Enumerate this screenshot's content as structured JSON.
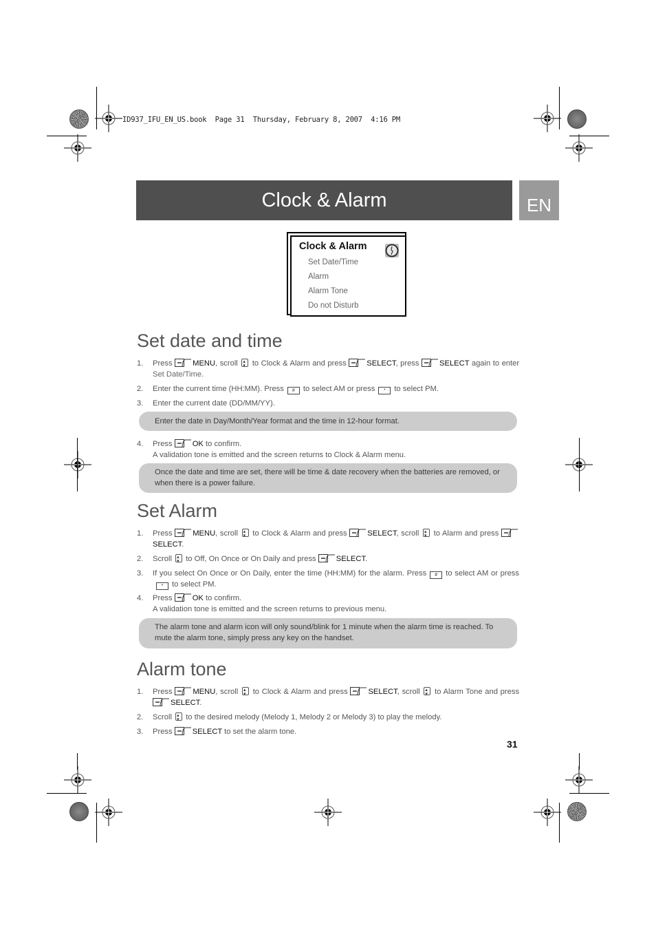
{
  "print_header": {
    "stamp": "ID937_IFU_EN_US.book  Page 31  Thursday, February 8, 2007  4:16 PM"
  },
  "title_band": {
    "title": "Clock & Alarm",
    "language_tab": "EN"
  },
  "menu_screen": {
    "title": "Clock & Alarm",
    "icon": "clock-icon",
    "items": [
      "Set Date/Time",
      "Alarm",
      "Alarm Tone",
      "Do not Disturb"
    ]
  },
  "keys": {
    "menu": "MENU",
    "select": "SELECT",
    "ok": "OK",
    "soft_key_icon": "soft-key-icon",
    "scroll_key_icon": "scroll-key-icon",
    "am_key_icon": "key-hash-icon",
    "pm_key_icon": "key-star-icon"
  },
  "sections": {
    "set_date_time": {
      "heading": "Set date and time",
      "step1": {
        "num": "1.",
        "press": "Press",
        "scroll": ", scroll",
        "to": "to Clock & Alarm and press",
        "press2": ", press",
        "again": "again to enter",
        "target": "Set Date/Time."
      },
      "step2": {
        "num": "2.",
        "a": "Enter the current time (HH:MM). Press",
        "b": "to select AM or press",
        "c": "to select PM."
      },
      "step3": {
        "num": "3.",
        "text": "Enter the current date (DD/MM/YY)."
      },
      "note1": "Enter the date in Day/Month/Year format and the time in 12-hour format.",
      "step4": {
        "num": "4.",
        "press": "Press",
        "confirm": "to confirm.",
        "result": "A validation tone is emitted and the screen returns to Clock & Alarm menu."
      },
      "note2": "Once the date and time are set, there will be time & date recovery when the batteries are removed, or when there is a power failure."
    },
    "set_alarm": {
      "heading": "Set Alarm",
      "step1": {
        "num": "1.",
        "press": "Press",
        "scroll": ", scroll",
        "to": "to Clock & Alarm and press",
        "scroll2": ", scroll",
        "to2": "to Alarm and press"
      },
      "step2": {
        "num": "2.",
        "a": "Scroll",
        "b": "to Off, On Once or On Daily and press"
      },
      "step3": {
        "num": "3.",
        "a": "If you select On Once or On Daily, enter the time (HH:MM) for the alarm. Press",
        "b": "to select AM or press",
        "c": "to select PM."
      },
      "step4": {
        "num": "4.",
        "press": "Press",
        "confirm": "to confirm.",
        "result": "A validation tone is emitted and the screen returns to previous menu."
      },
      "note": "The alarm tone and alarm icon will only sound/blink for 1 minute when the alarm time is reached. To mute the alarm tone, simply press any key on the handset."
    },
    "alarm_tone": {
      "heading": "Alarm tone",
      "step1": {
        "num": "1.",
        "press": "Press",
        "scroll": ", scroll",
        "to": "to Clock & Alarm and press",
        "scroll2": ", scroll",
        "to2": "to Alarm Tone and press"
      },
      "step2": {
        "num": "2.",
        "a": "Scroll",
        "b": "to the desired melody (Melody 1, Melody 2 or Melody 3) to play the melody."
      },
      "step3": {
        "num": "3.",
        "press": "Press",
        "b": "to set the alarm tone."
      }
    }
  },
  "page_number": "31"
}
